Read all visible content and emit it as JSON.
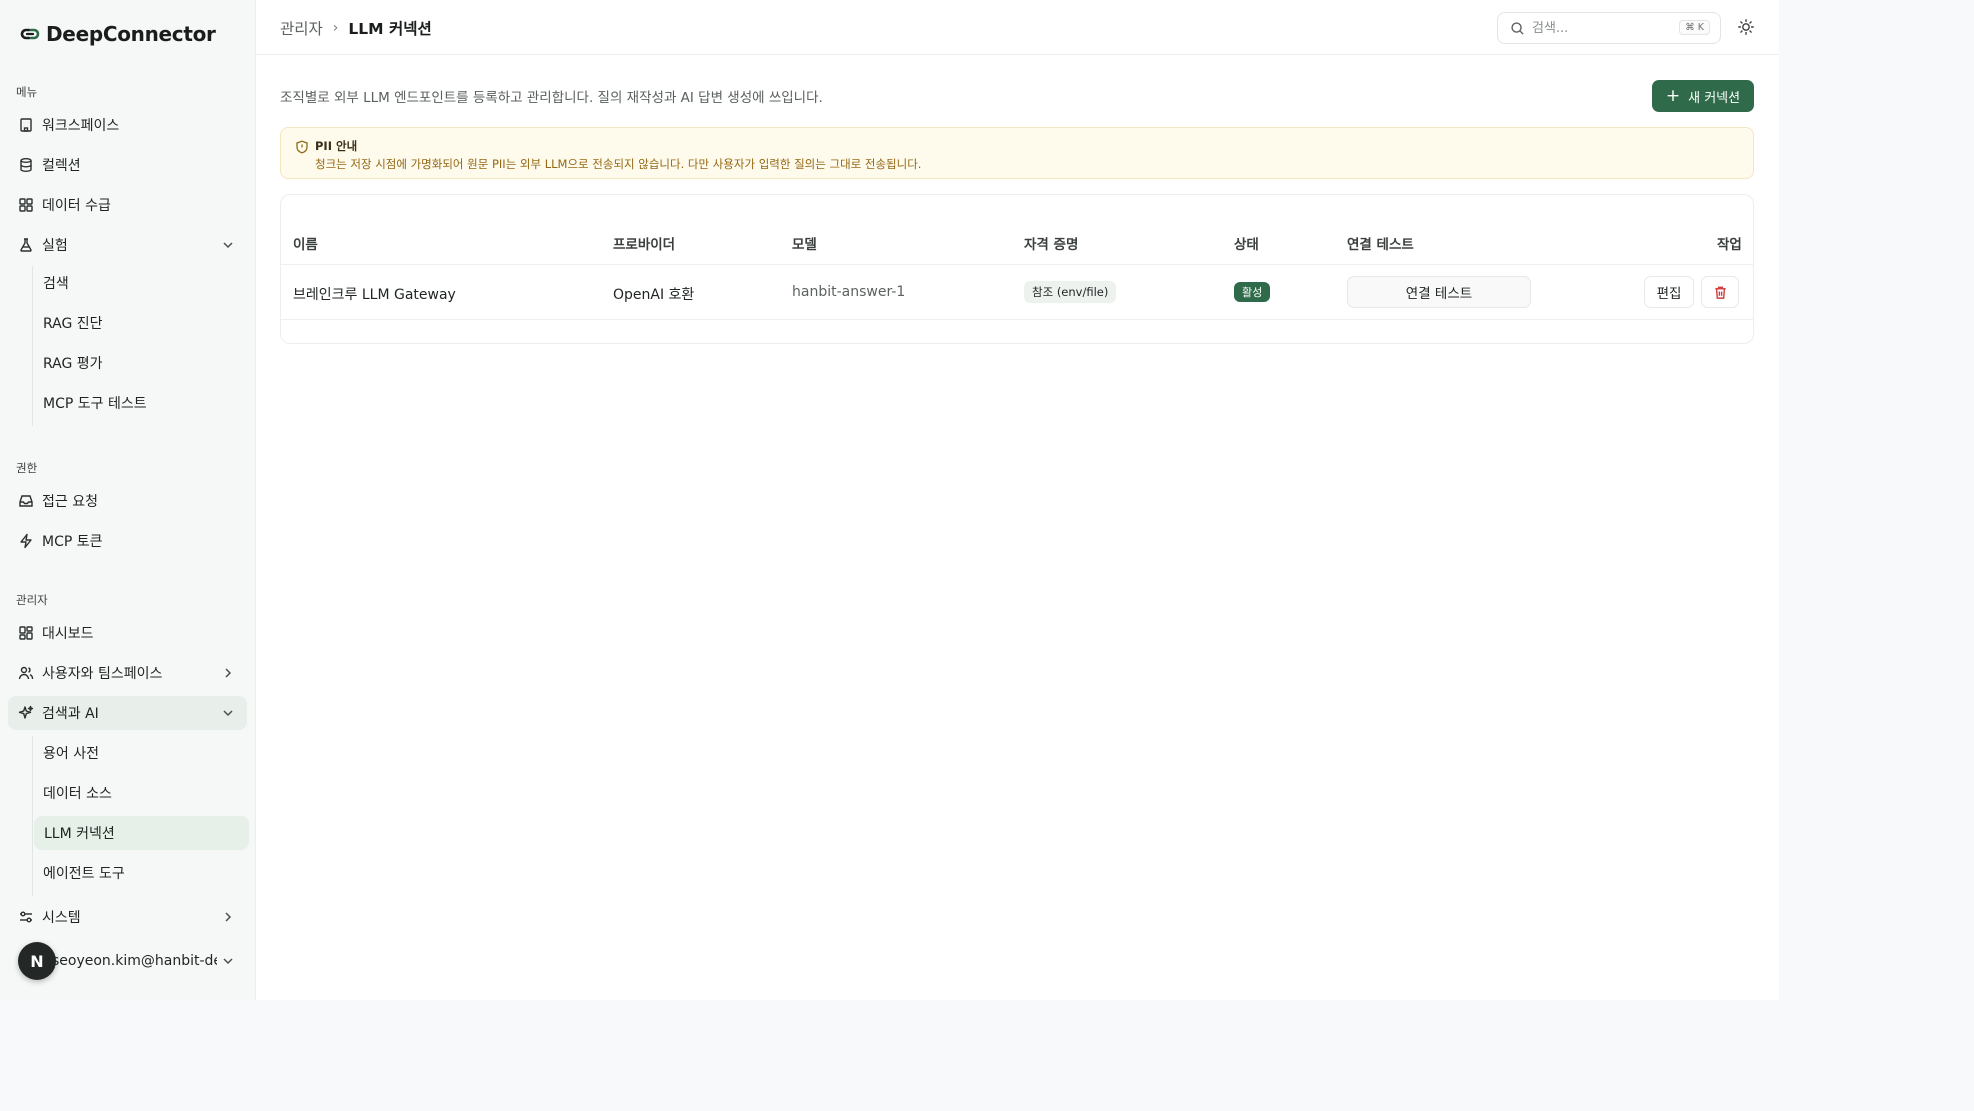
{
  "brand": {
    "name": "DeepConnector"
  },
  "sidebar": {
    "sections": {
      "menu": "메뉴",
      "permissions": "권한",
      "admin": "관리자"
    },
    "menu_items": {
      "workspace": "워크스페이스",
      "collection": "컬렉션",
      "ingestion": "데이터 수급",
      "experiment": "실험"
    },
    "experiment_sub": {
      "search": "검색",
      "rag_diagnosis": "RAG 진단",
      "rag_eval": "RAG 평가",
      "mcp_test": "MCP 도구 테스트"
    },
    "permission_items": {
      "access_request": "접근 요청",
      "mcp_token": "MCP 토큰"
    },
    "admin_items": {
      "dashboard": "대시보드",
      "users_teams": "사용자와 팀스페이스",
      "search_ai": "검색과 AI",
      "system": "시스템"
    },
    "search_ai_sub": {
      "glossary": "용어 사전",
      "data_source": "데이터 소스",
      "llm_connection": "LLM 커넥션",
      "agent_tools": "에이전트 도구"
    },
    "user": {
      "initial": "N",
      "email": "seoyeon.kim@hanbit-de..."
    }
  },
  "header": {
    "breadcrumb_root": "관리자",
    "breadcrumb_sep": "›",
    "breadcrumb_current": "LLM 커넥션",
    "search_placeholder": "검색...",
    "search_shortcut": "⌘ K"
  },
  "page": {
    "description": "조직별로 외부 LLM 엔드포인트를 등록하고 관리합니다. 질의 재작성과 AI 답변 생성에 쓰입니다.",
    "new_button": "새 커넥션",
    "notice": {
      "title": "PII 안내",
      "body": "청크는 저장 시점에 가명화되어 원문 PII는 외부 LLM으로 전송되지 않습니다. 다만 사용자가 입력한 질의는 그대로 전송됩니다."
    }
  },
  "table": {
    "headers": {
      "name": "이름",
      "provider": "프로바이더",
      "model": "모델",
      "credential": "자격 증명",
      "status": "상태",
      "connection_test": "연결 테스트",
      "actions": "작업"
    },
    "rows": [
      {
        "name": "브레인크루 LLM Gateway",
        "provider": "OpenAI 호환",
        "model": "hanbit-answer-1",
        "credential": "참조 (env/file)",
        "status": "활성",
        "test_button": "연결 테스트",
        "edit_button": "편집"
      }
    ]
  },
  "colors": {
    "accent": "#2f6b4a",
    "danger": "#d23b3b",
    "notice_bg": "#fefaec"
  },
  "icons": {
    "workspace": "building-icon",
    "collection": "database-icon",
    "ingestion": "grid-icon",
    "experiment": "flask-icon",
    "access_request": "inbox-icon",
    "mcp_token": "lightning-icon",
    "dashboard": "dashboard-icon",
    "users_teams": "users-icon",
    "search_ai": "sparkles-icon",
    "system": "sliders-icon",
    "notice": "shield-icon",
    "delete": "trash-icon",
    "theme": "sun-icon"
  }
}
